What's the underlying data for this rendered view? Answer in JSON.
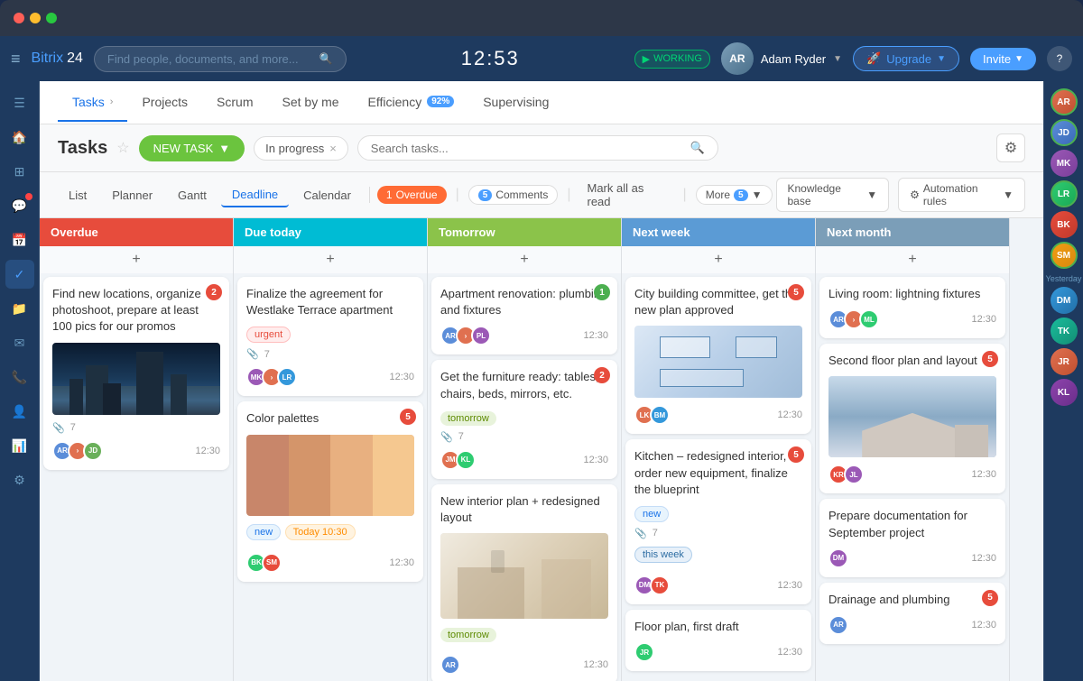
{
  "window": {
    "title": "Bitrix 24"
  },
  "topbar": {
    "logo_bitrix": "Bitrix",
    "logo_24": "24",
    "search_placeholder": "Find people, documents, and more...",
    "clock": "12:53",
    "working_label": "WORKING",
    "user_name": "Adam Ryder",
    "upgrade_label": "Upgrade",
    "invite_label": "Invite"
  },
  "tabs": [
    {
      "id": "tasks",
      "label": "Tasks",
      "active": true
    },
    {
      "id": "projects",
      "label": "Projects",
      "active": false
    },
    {
      "id": "scrum",
      "label": "Scrum",
      "active": false
    },
    {
      "id": "set-by-me",
      "label": "Set by me",
      "active": false
    },
    {
      "id": "efficiency",
      "label": "Efficiency",
      "badge": "92%",
      "active": false
    },
    {
      "id": "supervising",
      "label": "Supervising",
      "active": false
    }
  ],
  "toolbar": {
    "title": "Tasks",
    "new_task_label": "NEW TASK",
    "filter_label": "In progress",
    "settings_icon": "⚙"
  },
  "view_toolbar": {
    "views": [
      "List",
      "Planner",
      "Gantt",
      "Deadline",
      "Calendar"
    ],
    "active_view": "Deadline",
    "overdue_label": "Overdue",
    "overdue_count": 1,
    "comments_label": "Comments",
    "comments_count": 5,
    "mark_read_label": "Mark all as read",
    "more_label": "More",
    "more_count": 5,
    "knowledge_base_label": "Knowledge base",
    "automation_label": "Automation rules"
  },
  "columns": [
    {
      "id": "overdue",
      "label": "Overdue",
      "class": "overdue",
      "cards": [
        {
          "id": "c1",
          "title": "Find new locations, organize photoshoot, prepare at least 100 pics for our promos",
          "badge": 2,
          "badge_type": "red",
          "meta_icon": "📎",
          "meta_text": "7",
          "time": "12:30",
          "avatars": [
            "AR",
            "JD"
          ],
          "has_image": true,
          "image_type": "city"
        }
      ]
    },
    {
      "id": "due-today",
      "label": "Due today",
      "class": "due-today",
      "cards": [
        {
          "id": "c2",
          "title": "Finalize the agreement for Westlake Terrace apartment",
          "badge": null,
          "tag": "urgent",
          "tag_class": "tag-urgent",
          "meta_icon": "📎",
          "meta_text": "7",
          "time": "12:30",
          "avatars": [
            "MK",
            "LR"
          ]
        },
        {
          "id": "c3",
          "title": "Color palettes",
          "badge": 5,
          "badge_type": "red",
          "has_image": true,
          "image_type": "colors",
          "tag": "new",
          "tag_class": "tag-new",
          "tag2": "Today 10:30",
          "tag2_class": "tag-today",
          "time": "12:30",
          "avatars": [
            "BK",
            "SM"
          ]
        }
      ]
    },
    {
      "id": "tomorrow",
      "label": "Tomorrow",
      "class": "tomorrow",
      "cards": [
        {
          "id": "c4",
          "title": "Apartment renovation: plumbing and fixtures",
          "badge": 1,
          "badge_type": "green",
          "time": "12:30",
          "avatars": [
            "AR",
            "PL"
          ]
        },
        {
          "id": "c5",
          "title": "Get the furniture ready: tables, chairs, beds, mirrors, etc.",
          "badge": 2,
          "badge_type": "red",
          "tag": "tomorrow",
          "tag_class": "tag-tomorrow",
          "meta_icon": "📎",
          "meta_text": "7",
          "time": "12:30",
          "avatars": [
            "JM",
            "KL"
          ]
        },
        {
          "id": "c6",
          "title": "New interior plan + redesigned layout",
          "badge": null,
          "has_image": true,
          "image_type": "interior",
          "tag": "tomorrow",
          "tag_class": "tag-tomorrow",
          "time": "12:30",
          "avatars": [
            "AR"
          ]
        }
      ]
    },
    {
      "id": "next-week",
      "label": "Next week",
      "class": "next-week",
      "cards": [
        {
          "id": "c7",
          "title": "City building committee, get the new plan approved",
          "badge": 5,
          "badge_type": "red",
          "has_image": true,
          "image_type": "floorplan",
          "time": "12:30",
          "avatars": [
            "LK",
            "BM"
          ]
        },
        {
          "id": "c8",
          "title": "Kitchen – redesigned interior, order new equipment, finalize the blueprint",
          "badge": 5,
          "badge_type": "red",
          "tag": "new",
          "tag_class": "tag-new",
          "meta_icon": "📎",
          "meta_text": "7",
          "tag2": "this week",
          "tag2_class": "tag-thisweek",
          "time": "12:30",
          "avatars": [
            "DM",
            "TK"
          ]
        },
        {
          "id": "c9",
          "title": "Floor plan, first draft",
          "badge": null,
          "time": "12:30",
          "avatars": [
            "JR"
          ]
        }
      ]
    },
    {
      "id": "next-month",
      "label": "Next month",
      "class": "next-month",
      "cards": [
        {
          "id": "c10",
          "title": "Living room: lightning fixtures",
          "badge": null,
          "time": "12:30",
          "avatars": [
            "AR",
            "ML"
          ]
        },
        {
          "id": "c11",
          "title": "Second floor plan and layout",
          "badge": 5,
          "badge_type": "red",
          "has_image": true,
          "image_type": "house",
          "time": "12:30",
          "avatars": [
            "KR",
            "JL"
          ]
        },
        {
          "id": "c12",
          "title": "Prepare documentation for September project",
          "badge": null,
          "time": "12:30",
          "avatars": [
            "DM"
          ]
        },
        {
          "id": "c13",
          "title": "Drainage and plumbing",
          "badge": 5,
          "badge_type": "red",
          "time": "12:30",
          "avatars": [
            "AR"
          ]
        }
      ]
    }
  ],
  "right_sidebar": {
    "label_yesterday": "Yesterday",
    "avatars": [
      "AR",
      "JD",
      "MK",
      "LR",
      "BK",
      "SM",
      "DM",
      "TK",
      "JR",
      "KL"
    ]
  }
}
